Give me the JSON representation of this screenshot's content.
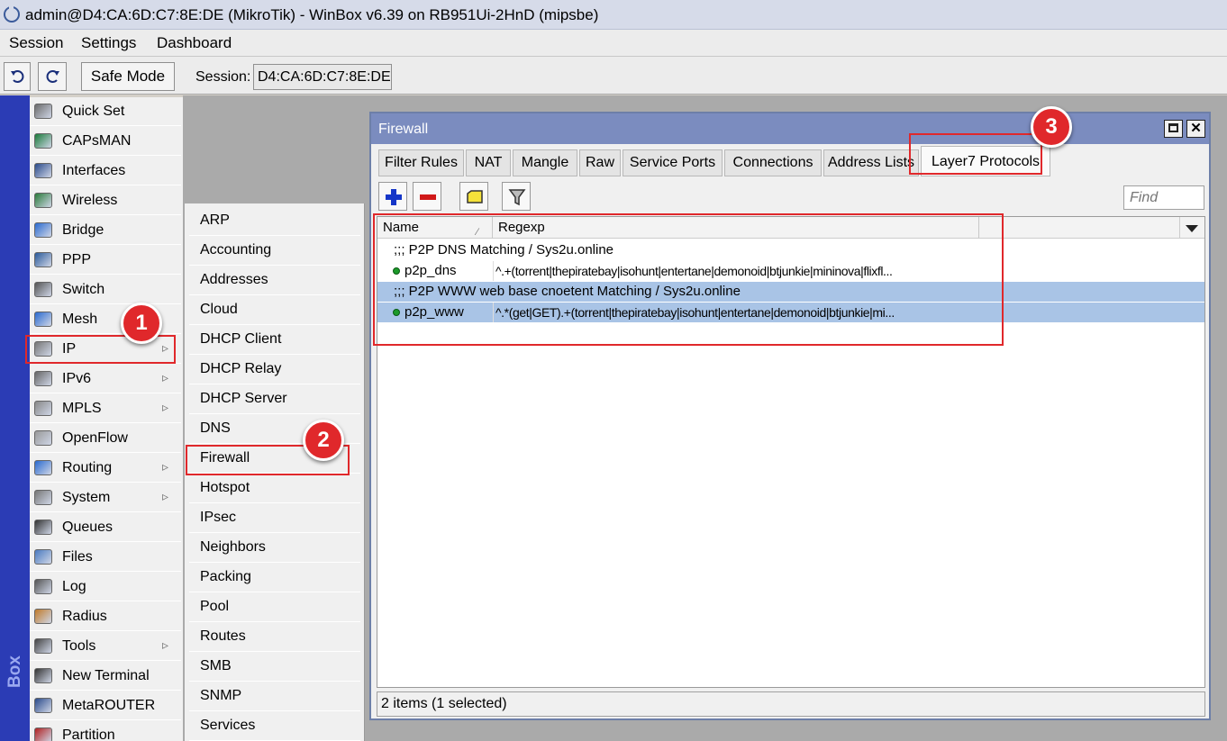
{
  "window": {
    "title": "admin@D4:CA:6D:C7:8E:DE (MikroTik) - WinBox v6.39 on RB951Ui-2HnD (mipsbe)"
  },
  "menubar": [
    "Session",
    "Settings",
    "Dashboard"
  ],
  "toolbar": {
    "safe_mode_label": "Safe Mode",
    "session_label": "Session:",
    "session_value": "D4:CA:6D:C7:8E:DE"
  },
  "side_strip_text": "Box",
  "left_menu": [
    {
      "label": "Quick Set",
      "icon": "quick-set-icon",
      "submenu": false
    },
    {
      "label": "CAPsMAN",
      "icon": "capsman-icon",
      "submenu": false
    },
    {
      "label": "Interfaces",
      "icon": "interfaces-icon",
      "submenu": false
    },
    {
      "label": "Wireless",
      "icon": "wireless-icon",
      "submenu": false
    },
    {
      "label": "Bridge",
      "icon": "bridge-icon",
      "submenu": false
    },
    {
      "label": "PPP",
      "icon": "ppp-icon",
      "submenu": false
    },
    {
      "label": "Switch",
      "icon": "switch-icon",
      "submenu": false
    },
    {
      "label": "Mesh",
      "icon": "mesh-icon",
      "submenu": false
    },
    {
      "label": "IP",
      "icon": "ip-icon",
      "submenu": true
    },
    {
      "label": "IPv6",
      "icon": "ipv6-icon",
      "submenu": true
    },
    {
      "label": "MPLS",
      "icon": "mpls-icon",
      "submenu": true
    },
    {
      "label": "OpenFlow",
      "icon": "openflow-icon",
      "submenu": false
    },
    {
      "label": "Routing",
      "icon": "routing-icon",
      "submenu": true
    },
    {
      "label": "System",
      "icon": "system-icon",
      "submenu": true
    },
    {
      "label": "Queues",
      "icon": "queues-icon",
      "submenu": false
    },
    {
      "label": "Files",
      "icon": "files-icon",
      "submenu": false
    },
    {
      "label": "Log",
      "icon": "log-icon",
      "submenu": false
    },
    {
      "label": "Radius",
      "icon": "radius-icon",
      "submenu": false
    },
    {
      "label": "Tools",
      "icon": "tools-icon",
      "submenu": true
    },
    {
      "label": "New Terminal",
      "icon": "terminal-icon",
      "submenu": false
    },
    {
      "label": "MetaROUTER",
      "icon": "metarouter-icon",
      "submenu": false
    },
    {
      "label": "Partition",
      "icon": "partition-icon",
      "submenu": false
    }
  ],
  "ip_submenu": [
    "ARP",
    "Accounting",
    "Addresses",
    "Cloud",
    "DHCP Client",
    "DHCP Relay",
    "DHCP Server",
    "DNS",
    "Firewall",
    "Hotspot",
    "IPsec",
    "Neighbors",
    "Packing",
    "Pool",
    "Routes",
    "SMB",
    "SNMP",
    "Services"
  ],
  "firewall": {
    "title": "Firewall",
    "tabs": [
      "Filter Rules",
      "NAT",
      "Mangle",
      "Raw",
      "Service Ports",
      "Connections",
      "Address Lists",
      "Layer7 Protocols"
    ],
    "active_tab": "Layer7 Protocols",
    "find_placeholder": "Find",
    "columns": [
      "Name",
      "Regexp"
    ],
    "rows": [
      {
        "type": "comment",
        "text": ";;; P2P DNS Matching / Sys2u.online",
        "selected": false
      },
      {
        "type": "item",
        "name": "p2p_dns",
        "regexp": "^.+(torrent|thepiratebay|isohunt|entertane|demonoid|btjunkie|mininova|flixfl...",
        "selected": false
      },
      {
        "type": "comment",
        "text": ";;; P2P WWW web base cnoetent Matching / Sys2u.online",
        "selected": true
      },
      {
        "type": "item",
        "name": "p2p_www",
        "regexp": "^.*(get|GET).+(torrent|thepiratebay|isohunt|entertane|demonoid|btjunkie|mi...",
        "selected": true
      }
    ],
    "status": "2 items (1 selected)"
  },
  "annotations": [
    "1",
    "2",
    "3"
  ],
  "colors": {
    "highlight": "#e0282b",
    "selection": "#a9c4e6",
    "title_bar": "#7b8cbf"
  }
}
